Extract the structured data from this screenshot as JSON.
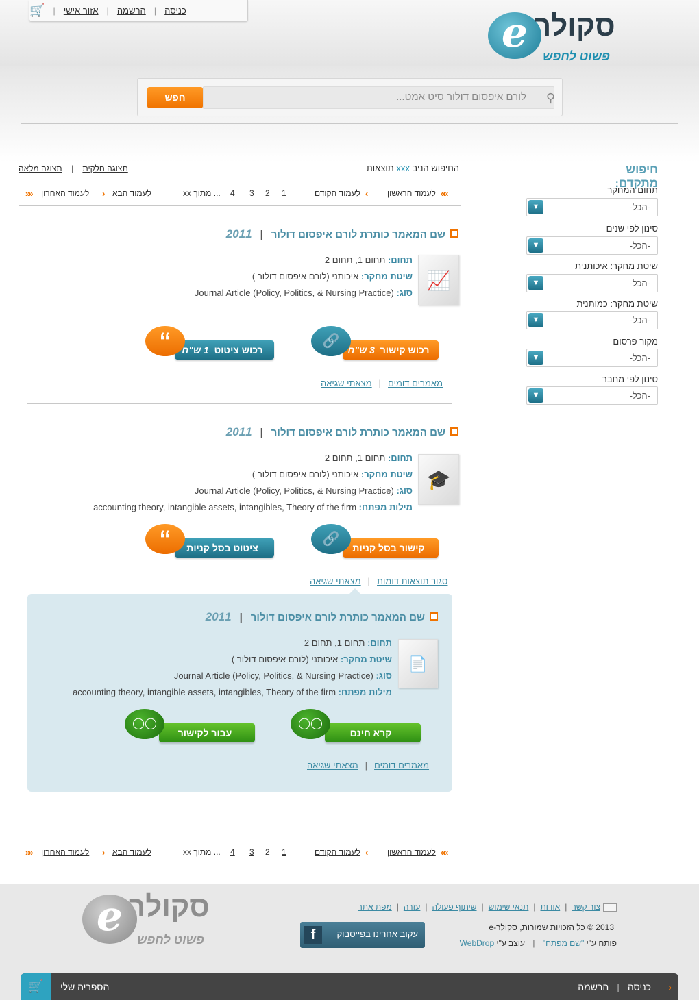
{
  "topnav": {
    "login": "כניסה",
    "register": "הרשמה",
    "personal": "אזור אישי",
    "cart_icon": "cart-icon"
  },
  "logo": {
    "letter": "e",
    "name": "סקולר",
    "tagline": "פשוט לחפש"
  },
  "search": {
    "placeholder": "לורם איפסום דולור סיט אמט...",
    "button": "חפש"
  },
  "sidebar": {
    "title": "חיפוש מתקדם:",
    "filters": [
      {
        "label": "תחום המחקר",
        "value": "-הכל-"
      },
      {
        "label": "סינון לפי שנים",
        "value": "-הכל-"
      },
      {
        "label": "שיטת מחקר: איכותנית",
        "value": "-הכל-"
      },
      {
        "label": "שיטת מחקר: כמותנית",
        "value": "-הכל-"
      },
      {
        "label": "מקור פרסום",
        "value": "-הכל-"
      },
      {
        "label": "סינון לפי מחבר",
        "value": "-הכל-"
      }
    ]
  },
  "results": {
    "prefix": "החיפוש הניב",
    "count": "xxx",
    "suffix": "תוצאות",
    "view_full": "תצוגה מלאה",
    "view_partial": "תצוגה חלקית"
  },
  "pager": {
    "first": "לעמוד הראשון",
    "prev": "לעמוד הקודם",
    "pages": [
      "1",
      "2",
      "3",
      "4"
    ],
    "of": "... מתוך xx",
    "next": "לעמוד הבא",
    "last": "לעמוד האחרון"
  },
  "items": [
    {
      "title": "שם המאמר כותרת לורם איפסום דולור",
      "year": "2011",
      "field_label": "תחום:",
      "field": "תחום 1, תחום 2",
      "method_label": "שיטת מחקר:",
      "method": "איכותני (לורם איפסום דולור )",
      "type_label": "סוג:",
      "type": "Journal Article (Policy, Politics, & Nursing Practice)",
      "thumb_icon": "chart-icon",
      "btn_link": "רכוש קישור",
      "btn_link_price": "3 ש\"ח",
      "btn_cite": "רכוש ציטוט",
      "btn_cite_price": "1 ש\"ח",
      "link_error": "מצאתי שגיאה",
      "link_similar": "מאמרים דומים"
    },
    {
      "title": "שם המאמר כותרת לורם איפסום דולור",
      "year": "2011",
      "field_label": "תחום:",
      "field": "תחום 1, תחום 2",
      "method_label": "שיטת מחקר:",
      "method": "איכותני (לורם איפסום דולור )",
      "type_label": "סוג:",
      "type": "Journal Article (Policy, Politics, & Nursing Practice)",
      "keywords_label": "מילות מפתח:",
      "keywords": "accounting theory, intangible assets, intangibles, Theory of the firm",
      "thumb_icon": "graduation-cap-icon",
      "btn_link": "קישור בסל קניות",
      "btn_cite": "ציטוט בסל קניות",
      "link_error": "מצאתי שגיאה",
      "link_close": "סגור תוצאות דומות"
    }
  ],
  "similar": {
    "title": "שם המאמר כותרת לורם איפסום דולור",
    "year": "2011",
    "field_label": "תחום:",
    "field": "תחום 1, תחום 2",
    "method_label": "שיטת מחקר:",
    "method": "איכותני (לורם איפסום דולור )",
    "type_label": "סוג:",
    "type": "Journal Article (Policy, Politics, & Nursing Practice)",
    "keywords_label": "מילות מפתח:",
    "keywords": "accounting theory, intangible assets, intangibles, Theory of the firm",
    "thumb_icon": "document-icon",
    "btn_read": "קרא חינם",
    "btn_go": "עבור לקישור",
    "link_error": "מצאתי שגיאה",
    "link_similar": "מאמרים דומים"
  },
  "footer": {
    "links": [
      "צור קשר",
      "אודות",
      "תנאי שימוש",
      "שיתוף פעולה",
      "עזרה",
      "מפת אתר"
    ],
    "copyright": "2013 © כל הזכויות שמורות, סקולר-e",
    "dev_prefix": "פותח ע\"י",
    "dev_name": "\"שם מפתח\"",
    "design_prefix": "עוצב ע\"י",
    "design_name": "WebDrop",
    "facebook": "עקוב אחרינו בפייסבוק"
  },
  "bottom_bar": {
    "login": "כניסה",
    "register": "הרשמה",
    "library": "הספריה שלי"
  },
  "colors": {
    "accent_orange": "#f07300",
    "accent_teal": "#2b8aa4",
    "accent_green": "#3b9e1a"
  }
}
